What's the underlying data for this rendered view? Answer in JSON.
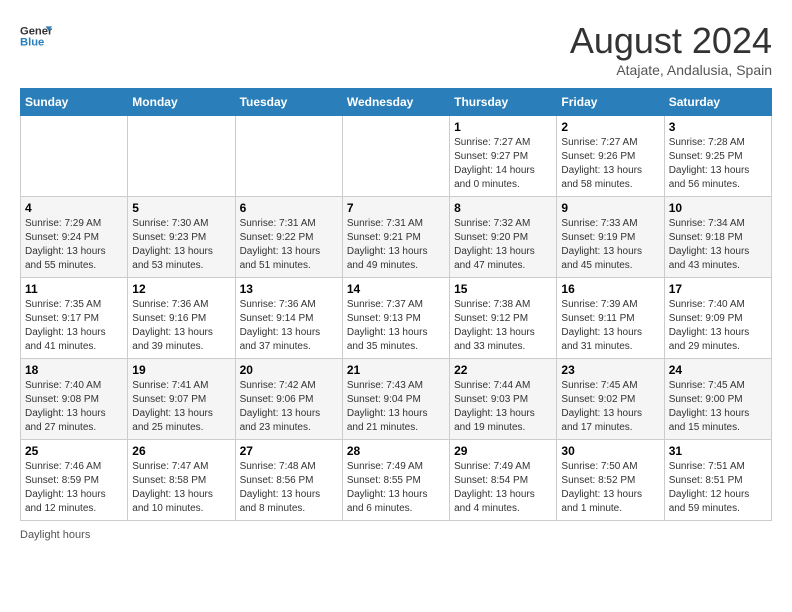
{
  "header": {
    "logo_line1": "General",
    "logo_line2": "Blue",
    "month_title": "August 2024",
    "subtitle": "Atajate, Andalusia, Spain"
  },
  "days_of_week": [
    "Sunday",
    "Monday",
    "Tuesday",
    "Wednesday",
    "Thursday",
    "Friday",
    "Saturday"
  ],
  "weeks": [
    [
      {
        "day": "",
        "info": ""
      },
      {
        "day": "",
        "info": ""
      },
      {
        "day": "",
        "info": ""
      },
      {
        "day": "",
        "info": ""
      },
      {
        "day": "1",
        "info": "Sunrise: 7:27 AM\nSunset: 9:27 PM\nDaylight: 14 hours\nand 0 minutes."
      },
      {
        "day": "2",
        "info": "Sunrise: 7:27 AM\nSunset: 9:26 PM\nDaylight: 13 hours\nand 58 minutes."
      },
      {
        "day": "3",
        "info": "Sunrise: 7:28 AM\nSunset: 9:25 PM\nDaylight: 13 hours\nand 56 minutes."
      }
    ],
    [
      {
        "day": "4",
        "info": "Sunrise: 7:29 AM\nSunset: 9:24 PM\nDaylight: 13 hours\nand 55 minutes."
      },
      {
        "day": "5",
        "info": "Sunrise: 7:30 AM\nSunset: 9:23 PM\nDaylight: 13 hours\nand 53 minutes."
      },
      {
        "day": "6",
        "info": "Sunrise: 7:31 AM\nSunset: 9:22 PM\nDaylight: 13 hours\nand 51 minutes."
      },
      {
        "day": "7",
        "info": "Sunrise: 7:31 AM\nSunset: 9:21 PM\nDaylight: 13 hours\nand 49 minutes."
      },
      {
        "day": "8",
        "info": "Sunrise: 7:32 AM\nSunset: 9:20 PM\nDaylight: 13 hours\nand 47 minutes."
      },
      {
        "day": "9",
        "info": "Sunrise: 7:33 AM\nSunset: 9:19 PM\nDaylight: 13 hours\nand 45 minutes."
      },
      {
        "day": "10",
        "info": "Sunrise: 7:34 AM\nSunset: 9:18 PM\nDaylight: 13 hours\nand 43 minutes."
      }
    ],
    [
      {
        "day": "11",
        "info": "Sunrise: 7:35 AM\nSunset: 9:17 PM\nDaylight: 13 hours\nand 41 minutes."
      },
      {
        "day": "12",
        "info": "Sunrise: 7:36 AM\nSunset: 9:16 PM\nDaylight: 13 hours\nand 39 minutes."
      },
      {
        "day": "13",
        "info": "Sunrise: 7:36 AM\nSunset: 9:14 PM\nDaylight: 13 hours\nand 37 minutes."
      },
      {
        "day": "14",
        "info": "Sunrise: 7:37 AM\nSunset: 9:13 PM\nDaylight: 13 hours\nand 35 minutes."
      },
      {
        "day": "15",
        "info": "Sunrise: 7:38 AM\nSunset: 9:12 PM\nDaylight: 13 hours\nand 33 minutes."
      },
      {
        "day": "16",
        "info": "Sunrise: 7:39 AM\nSunset: 9:11 PM\nDaylight: 13 hours\nand 31 minutes."
      },
      {
        "day": "17",
        "info": "Sunrise: 7:40 AM\nSunset: 9:09 PM\nDaylight: 13 hours\nand 29 minutes."
      }
    ],
    [
      {
        "day": "18",
        "info": "Sunrise: 7:40 AM\nSunset: 9:08 PM\nDaylight: 13 hours\nand 27 minutes."
      },
      {
        "day": "19",
        "info": "Sunrise: 7:41 AM\nSunset: 9:07 PM\nDaylight: 13 hours\nand 25 minutes."
      },
      {
        "day": "20",
        "info": "Sunrise: 7:42 AM\nSunset: 9:06 PM\nDaylight: 13 hours\nand 23 minutes."
      },
      {
        "day": "21",
        "info": "Sunrise: 7:43 AM\nSunset: 9:04 PM\nDaylight: 13 hours\nand 21 minutes."
      },
      {
        "day": "22",
        "info": "Sunrise: 7:44 AM\nSunset: 9:03 PM\nDaylight: 13 hours\nand 19 minutes."
      },
      {
        "day": "23",
        "info": "Sunrise: 7:45 AM\nSunset: 9:02 PM\nDaylight: 13 hours\nand 17 minutes."
      },
      {
        "day": "24",
        "info": "Sunrise: 7:45 AM\nSunset: 9:00 PM\nDaylight: 13 hours\nand 15 minutes."
      }
    ],
    [
      {
        "day": "25",
        "info": "Sunrise: 7:46 AM\nSunset: 8:59 PM\nDaylight: 13 hours\nand 12 minutes."
      },
      {
        "day": "26",
        "info": "Sunrise: 7:47 AM\nSunset: 8:58 PM\nDaylight: 13 hours\nand 10 minutes."
      },
      {
        "day": "27",
        "info": "Sunrise: 7:48 AM\nSunset: 8:56 PM\nDaylight: 13 hours\nand 8 minutes."
      },
      {
        "day": "28",
        "info": "Sunrise: 7:49 AM\nSunset: 8:55 PM\nDaylight: 13 hours\nand 6 minutes."
      },
      {
        "day": "29",
        "info": "Sunrise: 7:49 AM\nSunset: 8:54 PM\nDaylight: 13 hours\nand 4 minutes."
      },
      {
        "day": "30",
        "info": "Sunrise: 7:50 AM\nSunset: 8:52 PM\nDaylight: 13 hours\nand 1 minute."
      },
      {
        "day": "31",
        "info": "Sunrise: 7:51 AM\nSunset: 8:51 PM\nDaylight: 12 hours\nand 59 minutes."
      }
    ]
  ],
  "footer": {
    "daylight_label": "Daylight hours"
  }
}
